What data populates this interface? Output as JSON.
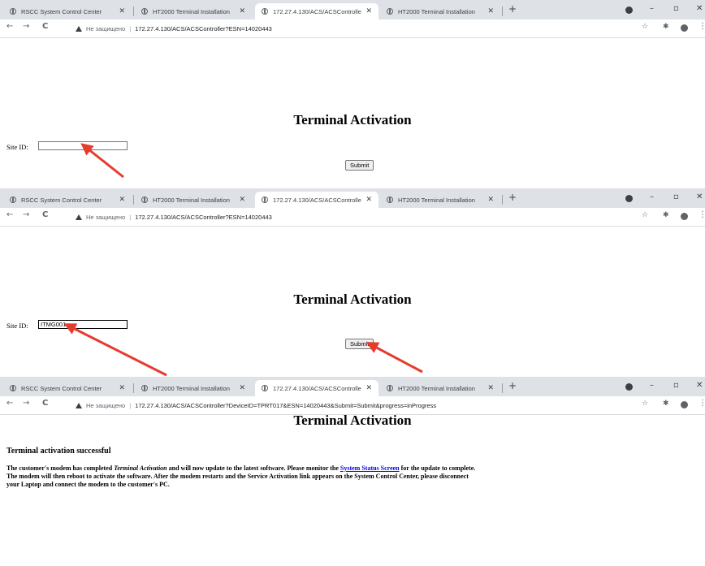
{
  "tabs": [
    {
      "title": "RSCC System Control Center",
      "close": "✕"
    },
    {
      "title": "HT2000 Terminal Installation",
      "close": "✕"
    },
    {
      "title": "172.27.4.130/ACS/ACSControlle",
      "close": "✕"
    },
    {
      "title": "HT2000 Terminal Installation",
      "close": "✕"
    }
  ],
  "new_tab": "+",
  "window_controls": {
    "minimize": "–",
    "maximize": "▫",
    "close": "✕"
  },
  "nav": {
    "back": "←",
    "forward": "→",
    "reload": "C"
  },
  "security": {
    "label": "Не защищено",
    "separator": "|"
  },
  "toolbar_icons": {
    "star": "☆",
    "extensions": "✱",
    "menu": "⋮"
  },
  "frames": [
    {
      "url": "172.27.4.130/ACS/ACSController?ESN=14020443",
      "site_id_value": ""
    },
    {
      "url": "172.27.4.130/ACS/ACSController?ESN=14020443",
      "site_id_value": "ITMG001"
    },
    {
      "url": "172.27.4.130/ACS/ACSController?DeviceID=TPRT017&ESN=14020443&Submit=Submit&progress=inProgress"
    }
  ],
  "page": {
    "heading": "Terminal Activation",
    "site_id_label": "Site ID:",
    "submit_label": "Submit",
    "success_text": "Terminal activation successful",
    "message": {
      "part1": "The customer's modem has completed ",
      "emphasis": "Terminal Activation",
      "part2": " and will now update to the latest software. Please monitor the ",
      "link": "System Status Screen",
      "part3": " for the update to complete.",
      "line2": "The modem will then reboot to activate the software. After the modem restarts and the Service Activation link appears on the System Control Center, please disconnect",
      "line3": "your Laptop and connect the modem to the customer's PC."
    }
  },
  "colors": {
    "arrow": "#e53c2e",
    "tabbar": "#dee1e6",
    "link": "#0000ee"
  }
}
